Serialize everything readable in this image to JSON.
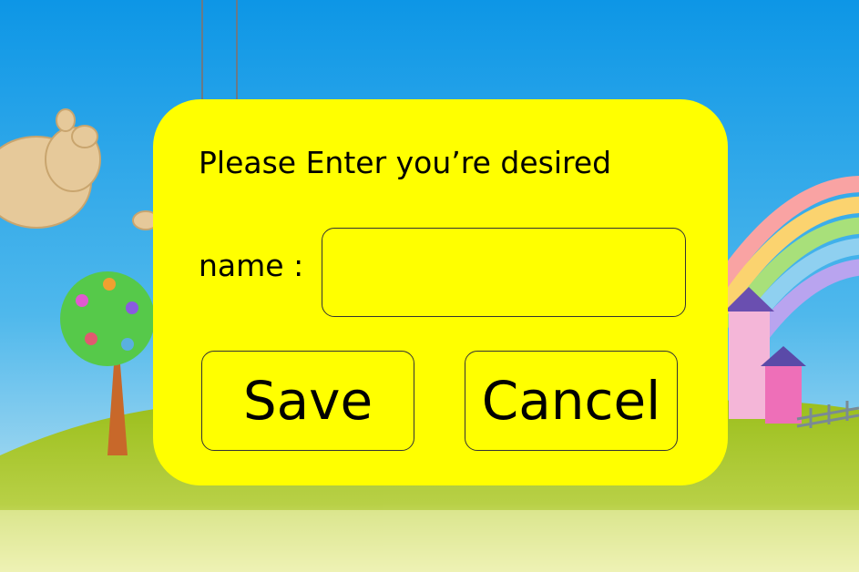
{
  "dialog": {
    "prompt": "Please Enter you’re desired",
    "name_label": "name :",
    "name_value": "",
    "save_label": "Save",
    "cancel_label": "Cancel"
  },
  "colors": {
    "sky": "#1aa0e8",
    "dialog": "#ffff00",
    "grass": "#8fb51e"
  }
}
